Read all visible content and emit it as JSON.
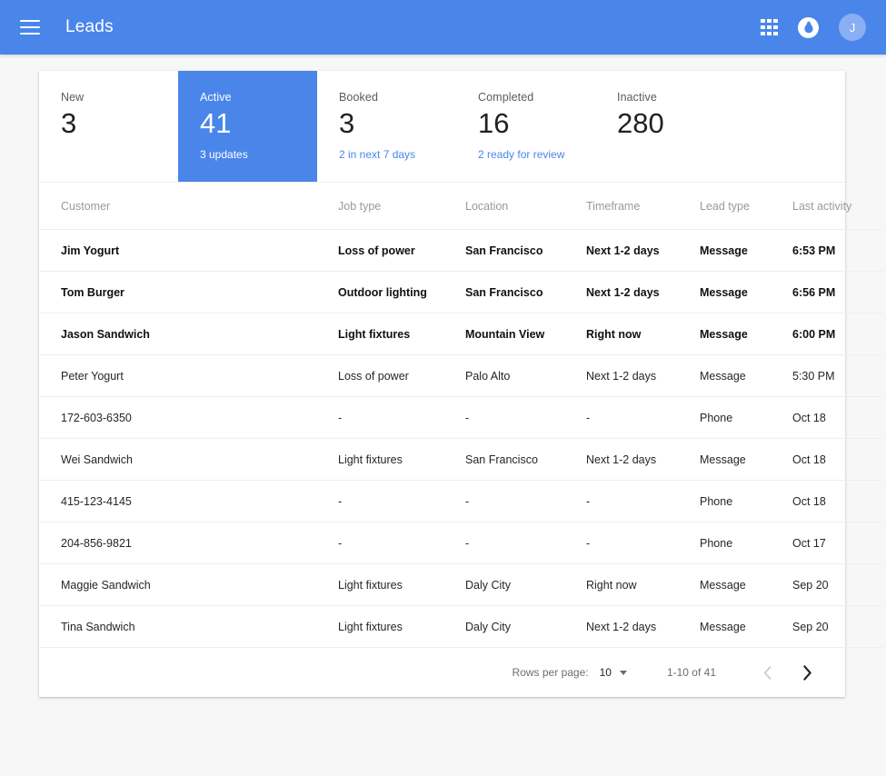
{
  "appbar": {
    "menu_icon": "hamburger-menu-icon",
    "title": "Leads",
    "apps_icon": "grid-apps-icon",
    "notifications_icon": "bell-notification-icon",
    "avatar_initial": "J"
  },
  "colors": {
    "accent": "#4a86ea",
    "page_bg": "#f7f7f7",
    "card_bg": "#ffffff",
    "divider": "#eeeeee",
    "text_primary": "#262626",
    "text_secondary": "#9a9a9a",
    "avatar_bg": "#89aef3"
  },
  "stats": [
    {
      "label": "New",
      "value": "3",
      "sub": "",
      "selected": false
    },
    {
      "label": "Active",
      "value": "41",
      "sub": "3 updates",
      "selected": true
    },
    {
      "label": "Booked",
      "value": "3",
      "sub": "2 in next 7 days",
      "selected": false
    },
    {
      "label": "Completed",
      "value": "16",
      "sub": "2 ready for review",
      "selected": false
    },
    {
      "label": "Inactive",
      "value": "280",
      "sub": "",
      "selected": false
    }
  ],
  "table": {
    "columns": [
      "Customer",
      "Job type",
      "Location",
      "Timeframe",
      "Lead type",
      "Last activity"
    ],
    "rows": [
      {
        "unread": true,
        "customer": "Jim Yogurt",
        "job_type": "Loss of power",
        "location": "San Francisco",
        "timeframe": "Next 1-2 days",
        "lead_type": "Message",
        "last_activity": "6:53 PM"
      },
      {
        "unread": true,
        "customer": "Tom Burger",
        "job_type": "Outdoor lighting",
        "location": "San Francisco",
        "timeframe": "Next 1-2 days",
        "lead_type": "Message",
        "last_activity": "6:56 PM"
      },
      {
        "unread": true,
        "customer": "Jason Sandwich",
        "job_type": "Light fixtures",
        "location": "Mountain View",
        "timeframe": "Right now",
        "lead_type": "Message",
        "last_activity": "6:00 PM"
      },
      {
        "unread": false,
        "customer": "Peter Yogurt",
        "job_type": "Loss of power",
        "location": "Palo Alto",
        "timeframe": "Next 1-2 days",
        "lead_type": "Message",
        "last_activity": "5:30 PM"
      },
      {
        "unread": false,
        "customer": "172-603-6350",
        "job_type": "-",
        "location": "-",
        "timeframe": "-",
        "lead_type": "Phone",
        "last_activity": "Oct 18"
      },
      {
        "unread": false,
        "customer": "Wei Sandwich",
        "job_type": "Light fixtures",
        "location": "San Francisco",
        "timeframe": "Next 1-2 days",
        "lead_type": "Message",
        "last_activity": "Oct 18"
      },
      {
        "unread": false,
        "customer": "415-123-4145",
        "job_type": "-",
        "location": "-",
        "timeframe": "-",
        "lead_type": "Phone",
        "last_activity": "Oct 18"
      },
      {
        "unread": false,
        "customer": "204-856-9821",
        "job_type": "-",
        "location": "-",
        "timeframe": "-",
        "lead_type": "Phone",
        "last_activity": "Oct 17"
      },
      {
        "unread": false,
        "customer": "Maggie Sandwich",
        "job_type": "Light fixtures",
        "location": "Daly City",
        "timeframe": "Right now",
        "lead_type": "Message",
        "last_activity": "Sep 20"
      },
      {
        "unread": false,
        "customer": "Tina Sandwich",
        "job_type": "Light fixtures",
        "location": "Daly City",
        "timeframe": "Next 1-2 days",
        "lead_type": "Message",
        "last_activity": "Sep 20"
      }
    ]
  },
  "pagination": {
    "rows_per_page_label": "Rows per page:",
    "rows_per_page_value": "10",
    "range_label": "1-10 of 41",
    "prev_icon": "chevron-left-icon",
    "next_icon": "chevron-right-icon",
    "prev_enabled": false,
    "next_enabled": true
  }
}
